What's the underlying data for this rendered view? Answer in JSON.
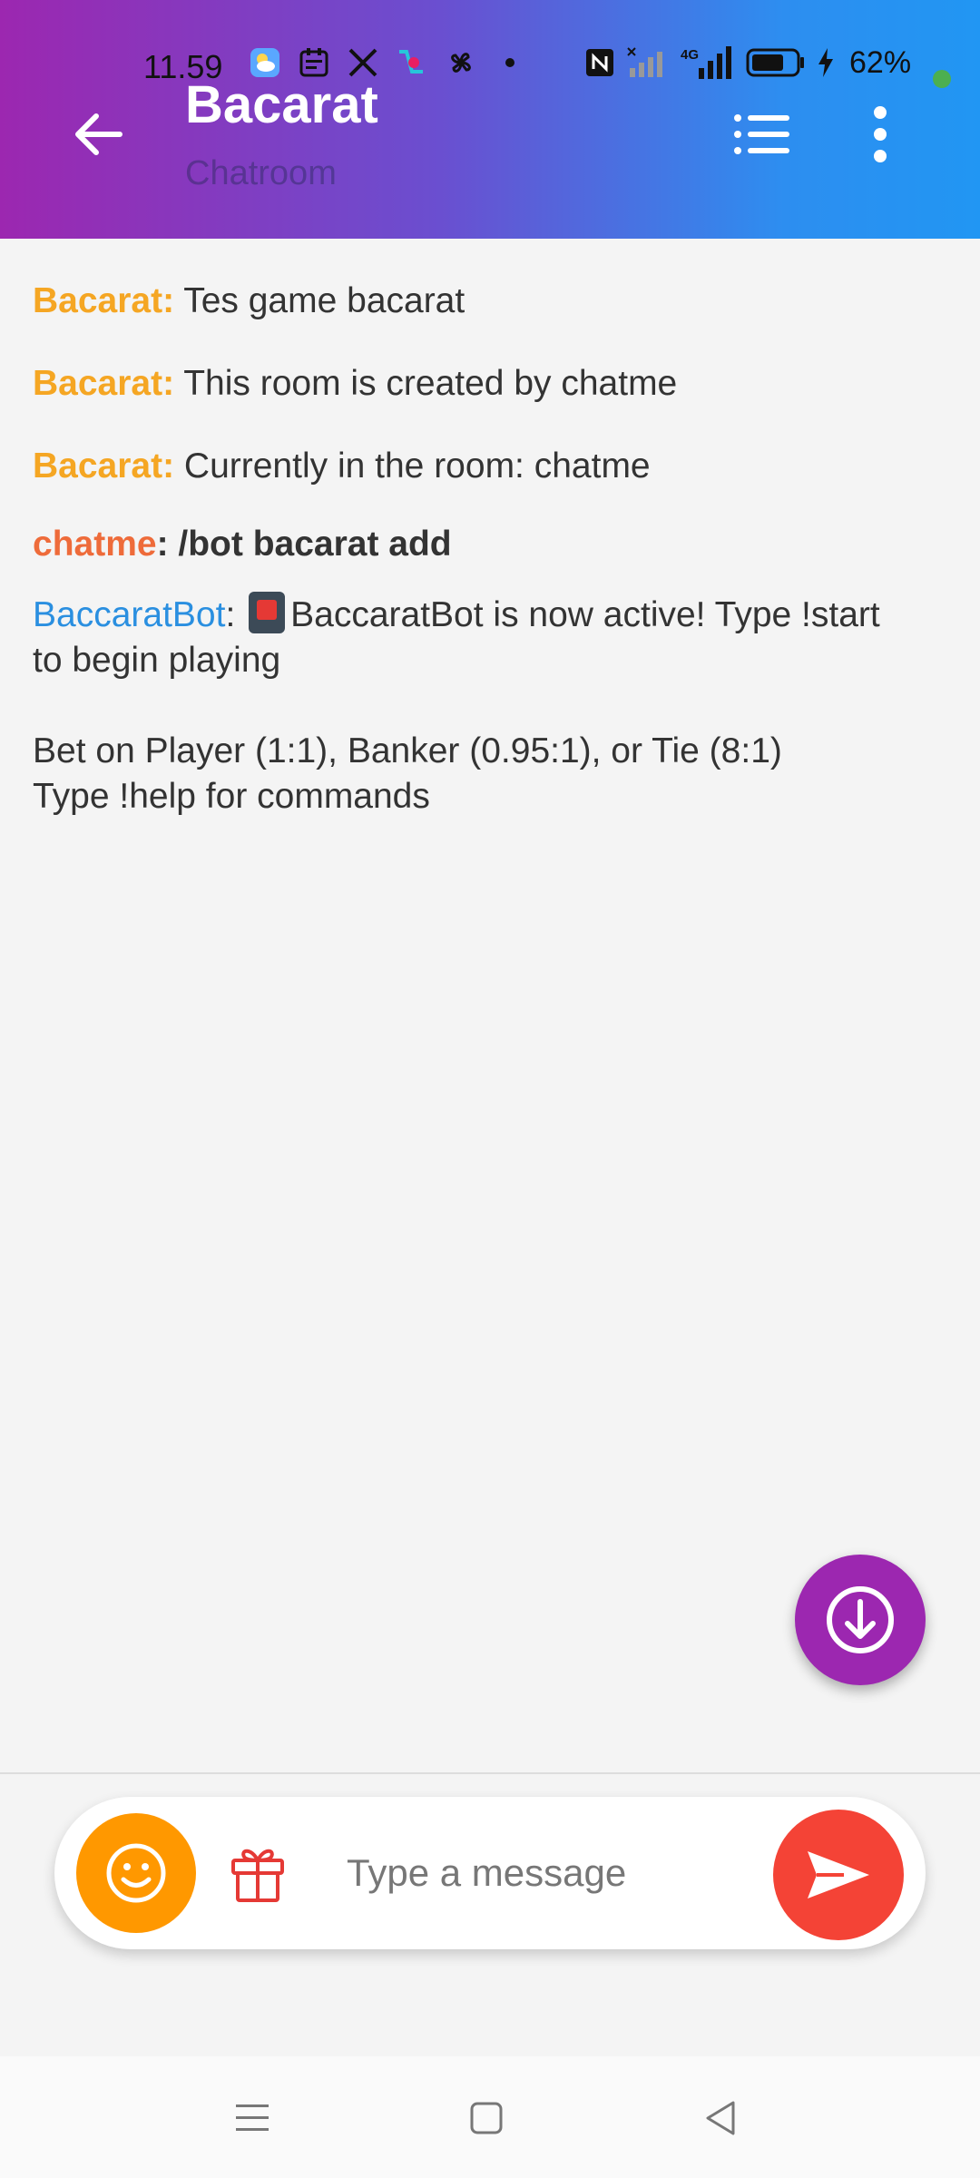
{
  "status_bar": {
    "time": "11.59",
    "battery_percent": "62%",
    "network": "4G",
    "icons_left": [
      "weather-icon",
      "calendar-app-icon",
      "x-logo-icon",
      "shopping-app-icon",
      "pinwheel-icon",
      "dot-icon"
    ],
    "icons_right": [
      "nfc-icon",
      "signal-icon",
      "signal-4g-icon",
      "battery-icon",
      "charging-icon"
    ]
  },
  "header": {
    "title": "Bacarat",
    "subtitle": "Chatroom",
    "gradient": [
      "#9c27b0",
      "#2196f3"
    ]
  },
  "messages": [
    {
      "sender": "Bacarat:",
      "sender_type": "system",
      "text": " Tes game bacarat"
    },
    {
      "sender": "Bacarat:",
      "sender_type": "system",
      "text": " This room is created by chatme"
    },
    {
      "sender": "Bacarat:",
      "sender_type": "system",
      "text": " Currently in the room: chatme"
    },
    {
      "sender": "chatme",
      "sender_type": "user",
      "text": ": /bot bacarat add"
    },
    {
      "sender": "BaccaratBot",
      "sender_type": "bot",
      "separator": ":",
      "emoji": "playing-card-icon",
      "text": "BaccaratBot is now active! Type !start to begin playing",
      "text_line2": "Bet on Player (1:1), Banker (0.95:1), or Tie (8:1)",
      "text_line3": "Type !help for commands"
    }
  ],
  "composer": {
    "placeholder": "Type a message",
    "value": ""
  },
  "colors": {
    "system_sender": "#f5a623",
    "user_sender": "#ee6b3a",
    "bot_sender": "#2a8fe0",
    "scroll_button": "#9c27b0",
    "emoji_button": "#ff9800",
    "send_button": "#f44336",
    "gift_icon": "#e53935"
  },
  "nav_bar": {
    "buttons": [
      "menu-icon",
      "home-icon",
      "back-triangle-icon"
    ]
  }
}
